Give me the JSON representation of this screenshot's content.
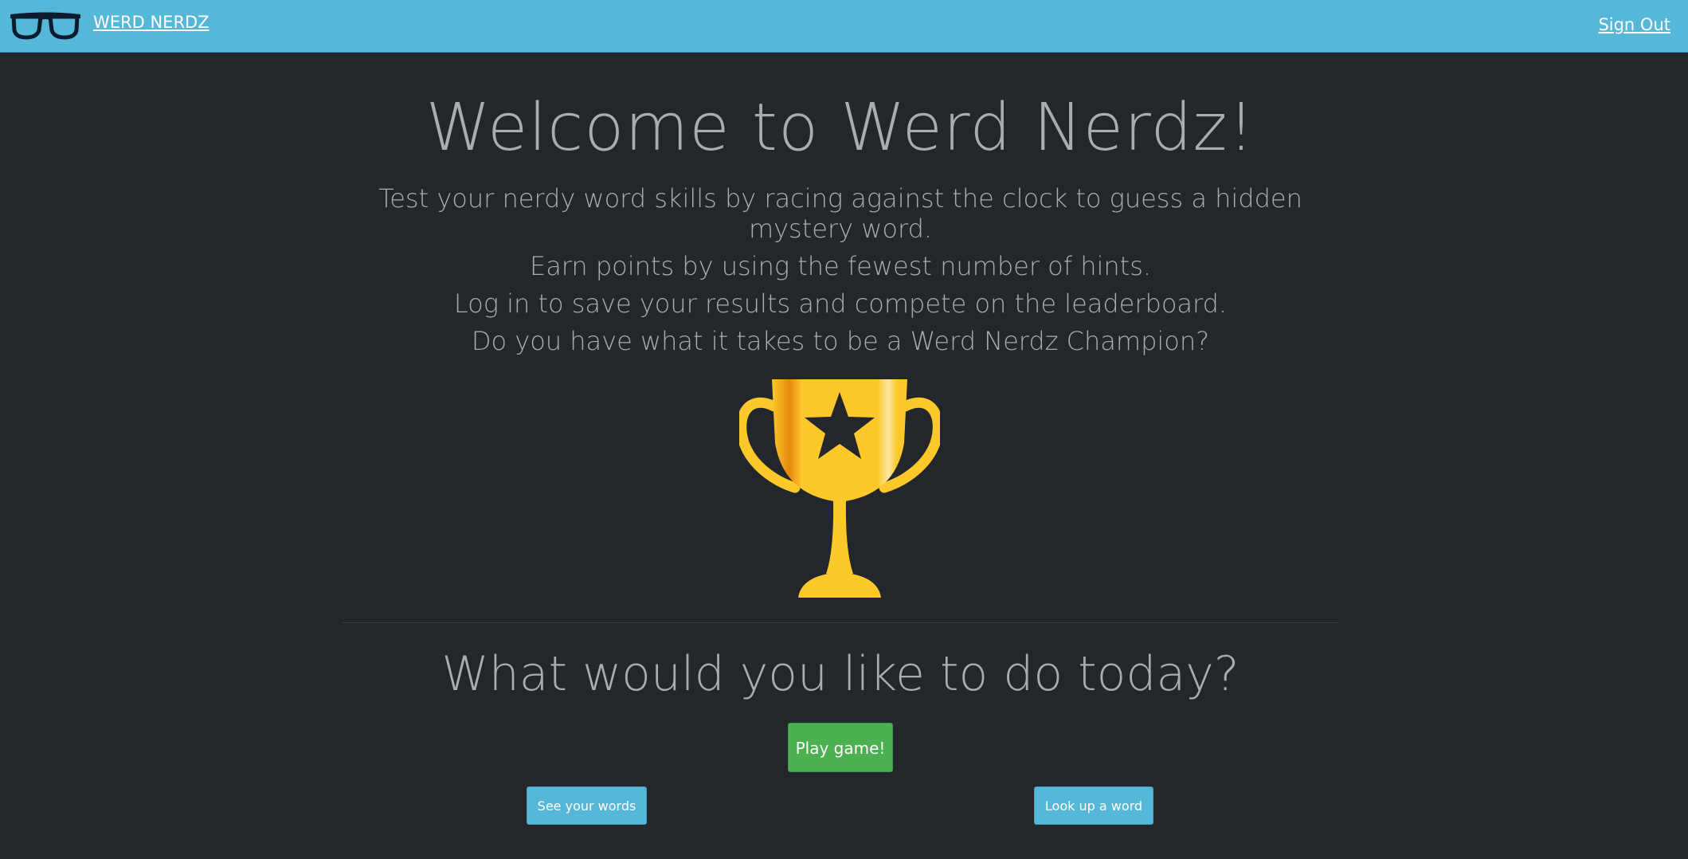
{
  "navbar": {
    "brand_label": "WERD NERDZ",
    "brand_icon": "glasses-icon",
    "sign_out_label": "Sign Out",
    "background_color": "#55b8d9"
  },
  "hero": {
    "title": "Welcome to Werd Nerdz!",
    "lines": [
      "Test your nerdy word skills by racing against the clock to guess a hidden mystery word.",
      "Earn points by using the fewest number of hints.",
      "Log in to save your results and compete on the leaderboard.",
      "Do you have what it takes to be a Werd Nerdz Champion?"
    ],
    "image_icon": "trophy-icon"
  },
  "actions": {
    "question": "What would you like to do today?",
    "play_label": "Play game!",
    "see_words_label": "See your words",
    "look_up_label": "Look up a word"
  },
  "colors": {
    "page_background": "#23262b",
    "text": "#a8adb2",
    "primary_button": "#55b8d9",
    "success_button": "#4cb050",
    "trophy_gold": "#fcc82a"
  }
}
